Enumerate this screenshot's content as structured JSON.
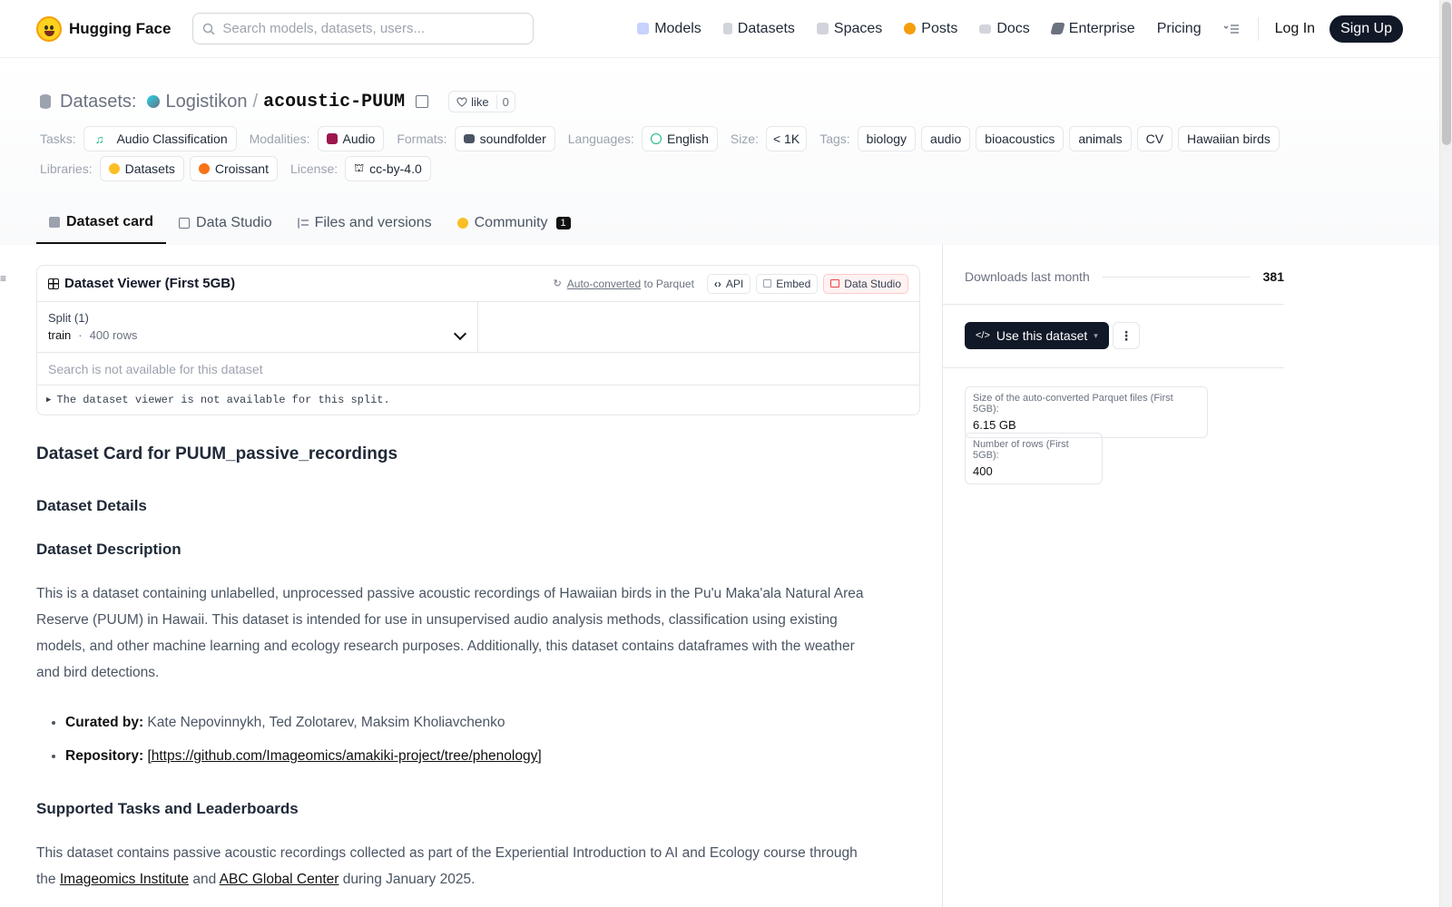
{
  "nav": {
    "brand": "Hugging Face",
    "search_placeholder": "Search models, datasets, users...",
    "links": [
      "Models",
      "Datasets",
      "Spaces",
      "Posts",
      "Docs",
      "Enterprise",
      "Pricing"
    ],
    "login": "Log In",
    "signup": "Sign Up"
  },
  "header": {
    "section": "Datasets:",
    "owner": "Logistikon",
    "slash": "/",
    "name": "acoustic-PUUM",
    "like_label": "like",
    "like_count": "0"
  },
  "meta": {
    "tasks_label": "Tasks:",
    "task": "Audio Classification",
    "modalities_label": "Modalities:",
    "modality": "Audio",
    "formats_label": "Formats:",
    "format": "soundfolder",
    "languages_label": "Languages:",
    "language": "English",
    "size_label": "Size:",
    "size": "< 1K",
    "tags_label": "Tags:",
    "tags": [
      "biology",
      "audio",
      "bioacoustics",
      "animals",
      "CV",
      "Hawaiian birds"
    ],
    "libraries_label": "Libraries:",
    "libraries": [
      "Datasets",
      "Croissant"
    ],
    "license_label": "License:",
    "license": "cc-by-4.0"
  },
  "tabs": {
    "card": "Dataset card",
    "studio": "Data Studio",
    "files": "Files and versions",
    "community": "Community",
    "community_count": "1"
  },
  "viewer": {
    "title": "Dataset Viewer (First 5GB)",
    "auto_converted": "Auto-converted",
    "to_parquet": "to Parquet",
    "api": "API",
    "embed": "Embed",
    "data_studio": "Data Studio",
    "split_label": "Split (1)",
    "split_name": "train",
    "split_dot": "·",
    "split_rows": "400 rows",
    "search_na": "Search is not available for this dataset",
    "not_available": "The dataset viewer is not available for this split."
  },
  "card": {
    "title": "Dataset Card for PUUM_passive_recordings",
    "details": "Dataset Details",
    "description_heading": "Dataset Description",
    "description": "This is a dataset containing unlabelled, unprocessed passive acoustic recordings of Hawaiian birds in the Pu'u Maka'ala Natural Area Reserve (PUUM) in Hawaii. This dataset is intended for use in unsupervised audio analysis methods, classification using existing models, and other machine learning and ecology research purposes. Additionally, this dataset contains dataframes with the weather and bird detections.",
    "curated_label": "Curated by:",
    "curated_value": " Kate Nepovinnykh, Ted Zolotarev, Maksim Kholiavchenko",
    "repo_label": "Repository:",
    "repo_link": "[https://github.com/Imageomics/amakiki-project/tree/phenology]",
    "tasks_heading": "Supported Tasks and Leaderboards",
    "tasks_text_1": "This dataset contains passive acoustic recordings collected as part of the Experiential Introduction to AI and Ecology course through the ",
    "tasks_link_1": "Imageomics Institute",
    "tasks_text_2": " and ",
    "tasks_link_2": "ABC Global Center",
    "tasks_text_3": " during January 2025."
  },
  "sidebar": {
    "downloads_label": "Downloads last month",
    "downloads_count": "381",
    "use_button": "Use this dataset",
    "parquet_size_label": "Size of the auto-converted Parquet files (First 5GB):",
    "parquet_size": "6.15 GB",
    "rows_label": "Number of rows (First 5GB):",
    "rows": "400"
  }
}
